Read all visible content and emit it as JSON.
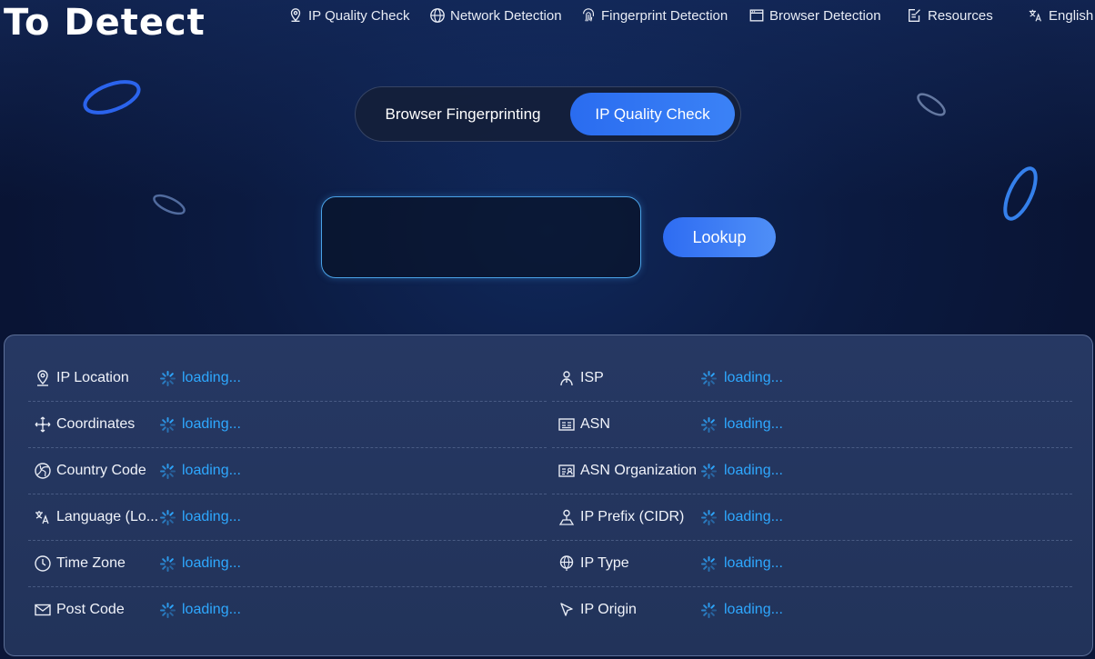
{
  "brand": {
    "logo_text": "To Detect"
  },
  "nav": {
    "items": [
      {
        "label": "IP Quality Check",
        "icon": "location-pin-icon"
      },
      {
        "label": "Network Detection",
        "icon": "globe-icon"
      },
      {
        "label": "Fingerprint Detection",
        "icon": "fingerprint-icon"
      },
      {
        "label": "Browser Detection",
        "icon": "browser-window-icon"
      },
      {
        "label": "Resources",
        "icon": "document-edit-icon"
      },
      {
        "label": "English",
        "icon": "translate-icon"
      }
    ]
  },
  "mode_switch": {
    "tabs": [
      {
        "label": "Browser Fingerprinting",
        "active": false
      },
      {
        "label": "IP Quality Check",
        "active": true
      }
    ]
  },
  "search": {
    "value": "",
    "placeholder": "",
    "button_label": "Lookup"
  },
  "results": {
    "left": [
      {
        "label": "IP Location",
        "icon": "location-pin-icon",
        "value": "loading..."
      },
      {
        "label": "Coordinates",
        "icon": "move-arrows-icon",
        "value": "loading..."
      },
      {
        "label": "Country Code",
        "icon": "globe-compass-icon",
        "value": "loading..."
      },
      {
        "label": "Language (Lo...",
        "icon": "translate-icon",
        "value": "loading..."
      },
      {
        "label": "Time Zone",
        "icon": "clock-icon",
        "value": "loading..."
      },
      {
        "label": "Post Code",
        "icon": "mail-icon",
        "value": "loading..."
      }
    ],
    "right": [
      {
        "label": "ISP",
        "icon": "user-network-icon",
        "value": "loading..."
      },
      {
        "label": "ASN",
        "icon": "id-card-icon",
        "value": "loading..."
      },
      {
        "label": "ASN Organization",
        "icon": "organization-card-icon",
        "value": "loading..."
      },
      {
        "label": "IP Prefix (CIDR)",
        "icon": "map-user-icon",
        "value": "loading..."
      },
      {
        "label": "IP Type",
        "icon": "globe-pin-icon",
        "value": "loading..."
      },
      {
        "label": "IP Origin",
        "icon": "cursor-arrow-icon",
        "value": "loading..."
      }
    ]
  },
  "colors": {
    "accent": "#3b82f6",
    "loading_text": "#2ea8ff",
    "input_border": "#4aa3e8"
  }
}
